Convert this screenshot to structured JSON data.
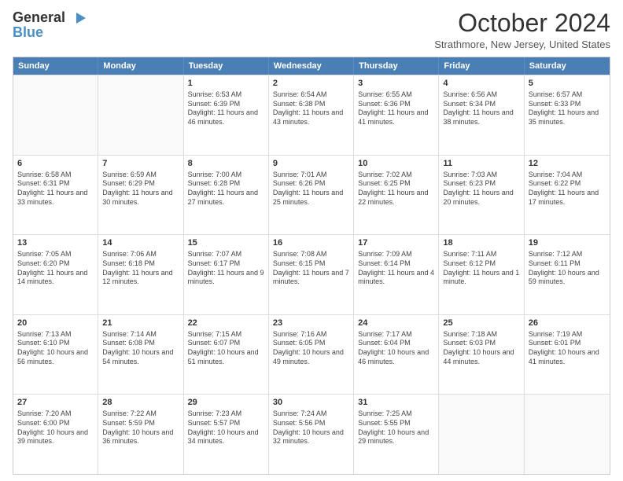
{
  "header": {
    "logo_line1": "General",
    "logo_line2": "Blue",
    "month_title": "October 2024",
    "subtitle": "Strathmore, New Jersey, United States"
  },
  "days": [
    "Sunday",
    "Monday",
    "Tuesday",
    "Wednesday",
    "Thursday",
    "Friday",
    "Saturday"
  ],
  "weeks": [
    [
      {
        "day": "",
        "empty": true
      },
      {
        "day": "",
        "empty": true
      },
      {
        "day": "1",
        "sunrise": "Sunrise: 6:53 AM",
        "sunset": "Sunset: 6:39 PM",
        "daylight": "Daylight: 11 hours and 46 minutes."
      },
      {
        "day": "2",
        "sunrise": "Sunrise: 6:54 AM",
        "sunset": "Sunset: 6:38 PM",
        "daylight": "Daylight: 11 hours and 43 minutes."
      },
      {
        "day": "3",
        "sunrise": "Sunrise: 6:55 AM",
        "sunset": "Sunset: 6:36 PM",
        "daylight": "Daylight: 11 hours and 41 minutes."
      },
      {
        "day": "4",
        "sunrise": "Sunrise: 6:56 AM",
        "sunset": "Sunset: 6:34 PM",
        "daylight": "Daylight: 11 hours and 38 minutes."
      },
      {
        "day": "5",
        "sunrise": "Sunrise: 6:57 AM",
        "sunset": "Sunset: 6:33 PM",
        "daylight": "Daylight: 11 hours and 35 minutes."
      }
    ],
    [
      {
        "day": "6",
        "sunrise": "Sunrise: 6:58 AM",
        "sunset": "Sunset: 6:31 PM",
        "daylight": "Daylight: 11 hours and 33 minutes."
      },
      {
        "day": "7",
        "sunrise": "Sunrise: 6:59 AM",
        "sunset": "Sunset: 6:29 PM",
        "daylight": "Daylight: 11 hours and 30 minutes."
      },
      {
        "day": "8",
        "sunrise": "Sunrise: 7:00 AM",
        "sunset": "Sunset: 6:28 PM",
        "daylight": "Daylight: 11 hours and 27 minutes."
      },
      {
        "day": "9",
        "sunrise": "Sunrise: 7:01 AM",
        "sunset": "Sunset: 6:26 PM",
        "daylight": "Daylight: 11 hours and 25 minutes."
      },
      {
        "day": "10",
        "sunrise": "Sunrise: 7:02 AM",
        "sunset": "Sunset: 6:25 PM",
        "daylight": "Daylight: 11 hours and 22 minutes."
      },
      {
        "day": "11",
        "sunrise": "Sunrise: 7:03 AM",
        "sunset": "Sunset: 6:23 PM",
        "daylight": "Daylight: 11 hours and 20 minutes."
      },
      {
        "day": "12",
        "sunrise": "Sunrise: 7:04 AM",
        "sunset": "Sunset: 6:22 PM",
        "daylight": "Daylight: 11 hours and 17 minutes."
      }
    ],
    [
      {
        "day": "13",
        "sunrise": "Sunrise: 7:05 AM",
        "sunset": "Sunset: 6:20 PM",
        "daylight": "Daylight: 11 hours and 14 minutes."
      },
      {
        "day": "14",
        "sunrise": "Sunrise: 7:06 AM",
        "sunset": "Sunset: 6:18 PM",
        "daylight": "Daylight: 11 hours and 12 minutes."
      },
      {
        "day": "15",
        "sunrise": "Sunrise: 7:07 AM",
        "sunset": "Sunset: 6:17 PM",
        "daylight": "Daylight: 11 hours and 9 minutes."
      },
      {
        "day": "16",
        "sunrise": "Sunrise: 7:08 AM",
        "sunset": "Sunset: 6:15 PM",
        "daylight": "Daylight: 11 hours and 7 minutes."
      },
      {
        "day": "17",
        "sunrise": "Sunrise: 7:09 AM",
        "sunset": "Sunset: 6:14 PM",
        "daylight": "Daylight: 11 hours and 4 minutes."
      },
      {
        "day": "18",
        "sunrise": "Sunrise: 7:11 AM",
        "sunset": "Sunset: 6:12 PM",
        "daylight": "Daylight: 11 hours and 1 minute."
      },
      {
        "day": "19",
        "sunrise": "Sunrise: 7:12 AM",
        "sunset": "Sunset: 6:11 PM",
        "daylight": "Daylight: 10 hours and 59 minutes."
      }
    ],
    [
      {
        "day": "20",
        "sunrise": "Sunrise: 7:13 AM",
        "sunset": "Sunset: 6:10 PM",
        "daylight": "Daylight: 10 hours and 56 minutes."
      },
      {
        "day": "21",
        "sunrise": "Sunrise: 7:14 AM",
        "sunset": "Sunset: 6:08 PM",
        "daylight": "Daylight: 10 hours and 54 minutes."
      },
      {
        "day": "22",
        "sunrise": "Sunrise: 7:15 AM",
        "sunset": "Sunset: 6:07 PM",
        "daylight": "Daylight: 10 hours and 51 minutes."
      },
      {
        "day": "23",
        "sunrise": "Sunrise: 7:16 AM",
        "sunset": "Sunset: 6:05 PM",
        "daylight": "Daylight: 10 hours and 49 minutes."
      },
      {
        "day": "24",
        "sunrise": "Sunrise: 7:17 AM",
        "sunset": "Sunset: 6:04 PM",
        "daylight": "Daylight: 10 hours and 46 minutes."
      },
      {
        "day": "25",
        "sunrise": "Sunrise: 7:18 AM",
        "sunset": "Sunset: 6:03 PM",
        "daylight": "Daylight: 10 hours and 44 minutes."
      },
      {
        "day": "26",
        "sunrise": "Sunrise: 7:19 AM",
        "sunset": "Sunset: 6:01 PM",
        "daylight": "Daylight: 10 hours and 41 minutes."
      }
    ],
    [
      {
        "day": "27",
        "sunrise": "Sunrise: 7:20 AM",
        "sunset": "Sunset: 6:00 PM",
        "daylight": "Daylight: 10 hours and 39 minutes."
      },
      {
        "day": "28",
        "sunrise": "Sunrise: 7:22 AM",
        "sunset": "Sunset: 5:59 PM",
        "daylight": "Daylight: 10 hours and 36 minutes."
      },
      {
        "day": "29",
        "sunrise": "Sunrise: 7:23 AM",
        "sunset": "Sunset: 5:57 PM",
        "daylight": "Daylight: 10 hours and 34 minutes."
      },
      {
        "day": "30",
        "sunrise": "Sunrise: 7:24 AM",
        "sunset": "Sunset: 5:56 PM",
        "daylight": "Daylight: 10 hours and 32 minutes."
      },
      {
        "day": "31",
        "sunrise": "Sunrise: 7:25 AM",
        "sunset": "Sunset: 5:55 PM",
        "daylight": "Daylight: 10 hours and 29 minutes."
      },
      {
        "day": "",
        "empty": true
      },
      {
        "day": "",
        "empty": true
      }
    ]
  ]
}
